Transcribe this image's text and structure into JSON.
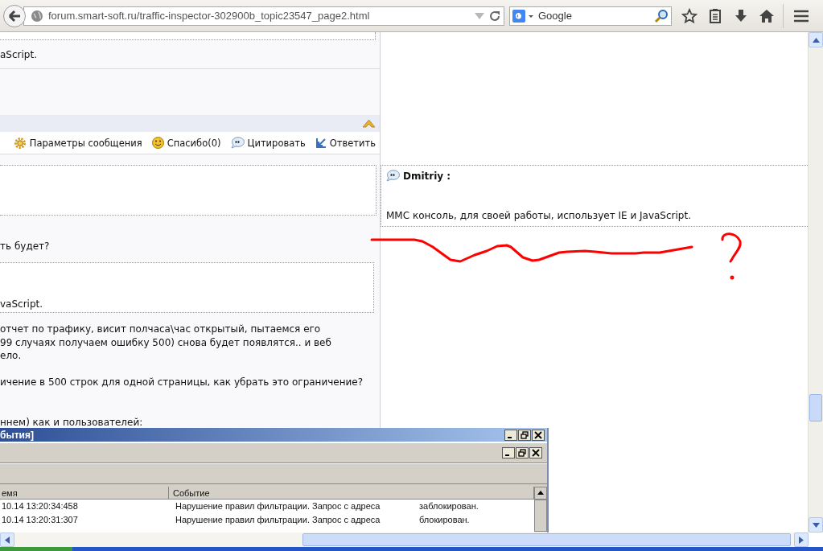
{
  "browser": {
    "url": "forum.smart-soft.ru/traffic-inspector-302900b_topic23547_page2.html",
    "search": {
      "placeholder": "Google"
    }
  },
  "left_column": {
    "quote_tail_top": "aScript.",
    "post_actions": [
      {
        "kind": "settings",
        "label": "Параметры сообщения"
      },
      {
        "kind": "thanks",
        "label": "Спасибо(0)"
      },
      {
        "kind": "quote",
        "label": "Цитировать"
      },
      {
        "kind": "reply",
        "label": "Ответить"
      }
    ],
    "question_line": "ть будет?",
    "quote_tail": "vaScript.",
    "paragraphs": [
      [
        "отчет по трафику, висит полчаса\\час открытый, пытаемся его",
        "99 случаях получаем ошибку 500) снова будет появлятся.. и веб",
        "ело."
      ],
      [
        "ичение в 500 строк для одной страницы, как убрать это ограничение?"
      ]
    ],
    "list_intro": "ннем) как и пользователей:"
  },
  "right_column": {
    "quote": {
      "author": "Dmitriy :",
      "text": "MMC консоль, для своей работы, использует IE и JavaScript."
    }
  },
  "app_window": {
    "title": "бытия]",
    "columns": [
      "емя",
      "Событие"
    ],
    "rows": [
      {
        "time": "10.14 13:20:34:458",
        "event": "Нарушение правил фильтрации. Запрос с адреса",
        "result": "заблокирован."
      },
      {
        "time": "10.14 13:20:31:307",
        "event": "Нарушение правил фильтрации. Запрос с адреса",
        "result": "блокирован."
      }
    ]
  }
}
